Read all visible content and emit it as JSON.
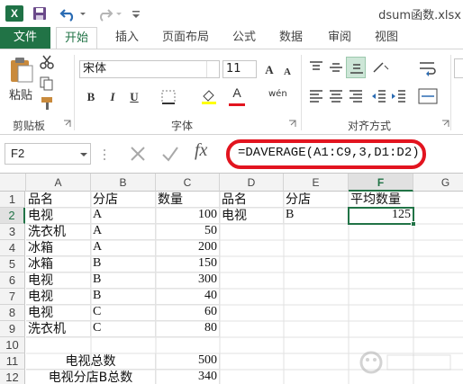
{
  "window": {
    "title": "dsum函数.xlsx"
  },
  "quick_access": {
    "app_icon": "X"
  },
  "tabs": [
    {
      "label": "文件"
    },
    {
      "label": "开始"
    },
    {
      "label": "插入"
    },
    {
      "label": "页面布局"
    },
    {
      "label": "公式"
    },
    {
      "label": "数据"
    },
    {
      "label": "审阅"
    },
    {
      "label": "视图"
    }
  ],
  "ribbon": {
    "paste_label": "粘贴",
    "clipboard_label": "剪贴板",
    "font_name": "宋体",
    "font_size": "11",
    "font_group_label": "字体",
    "bold": "B",
    "italic": "I",
    "underline": "U",
    "font_color_glyph": "A",
    "grow_font": "A",
    "shrink_font": "A",
    "phonetic": "wén",
    "align_group_label": "对齐方式"
  },
  "formula_bar": {
    "name_box": "F2",
    "fx": "fx",
    "formula": "=DAVERAGE(A1:C9,3,D1:D2)"
  },
  "columns": [
    "A",
    "B",
    "C",
    "D",
    "E",
    "F",
    "G"
  ],
  "selected_column": "F",
  "rows": [
    "1",
    "2",
    "3",
    "4",
    "5",
    "6",
    "7",
    "8",
    "9",
    "10",
    "11",
    "12"
  ],
  "selected_row": "2",
  "cells": {
    "A1": "品名",
    "B1": "分店",
    "C1": "数量",
    "D1": "品名",
    "E1": "分店",
    "F1": "平均数量",
    "A2": "电视",
    "B2": "A",
    "C2": "100",
    "D2": "电视",
    "E2": "B",
    "F2": "125",
    "A3": "洗衣机",
    "B3": "A",
    "C3": "50",
    "A4": "冰箱",
    "B4": "A",
    "C4": "200",
    "A5": "冰箱",
    "B5": "B",
    "C5": "150",
    "A6": "电视",
    "B6": "B",
    "C6": "300",
    "A7": "电视",
    "B7": "B",
    "C7": "40",
    "A8": "电视",
    "B8": "C",
    "C8": "60",
    "A9": "洗衣机",
    "B9": "C",
    "C9": "80",
    "A11": "电视总数",
    "C11": "500",
    "A12": "电视分店B总数",
    "C12": "340"
  },
  "colors": {
    "accent": "#217346",
    "highlight_ring": "#e2141f"
  }
}
